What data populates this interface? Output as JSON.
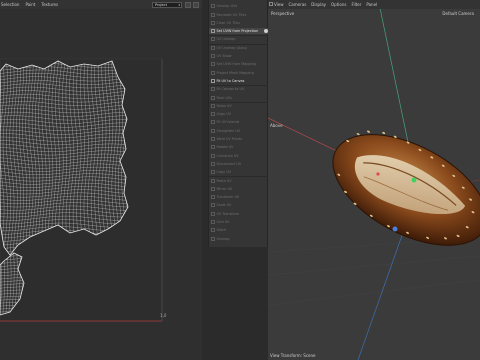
{
  "uv_editor": {
    "menu": [
      "Selection",
      "Paint",
      "Textures"
    ],
    "mode_select": "Project",
    "corner_label": "1,0"
  },
  "command_menu": {
    "items": [
      {
        "label": "Unwrap UVs",
        "enabled": false
      },
      {
        "label": "Recreate UV Tiles",
        "enabled": false
      },
      {
        "label": "Clear UV Tiles",
        "enabled": false
      },
      {
        "label": "Set UVW from Projection",
        "enabled": true,
        "highlighted": true,
        "has_options": true
      },
      {
        "label": "UV Unwrap",
        "enabled": false
      },
      {
        "label": "UV Unwrap (Auto)",
        "enabled": false
      },
      {
        "label": "UV Show",
        "enabled": false
      },
      {
        "label": "Set UVW from Mapping",
        "enabled": false
      },
      {
        "label": "Project Mesh Mapping",
        "enabled": false
      },
      {
        "label": "Fit UV to Canvas",
        "enabled": true
      },
      {
        "label": "Fit Canvas to UV",
        "enabled": false
      },
      {
        "label": "Pack UVs",
        "enabled": false
      },
      {
        "label": "Relax UV",
        "enabled": false
      },
      {
        "label": "Align UV",
        "enabled": false
      },
      {
        "label": "Fit UV Islands",
        "enabled": false
      },
      {
        "label": "Straighten UV",
        "enabled": false
      },
      {
        "label": "Weld UV Points",
        "enabled": false
      },
      {
        "label": "Rotate UV",
        "enabled": false
      },
      {
        "label": "Constrain UV",
        "enabled": false
      },
      {
        "label": "Disconnect UV",
        "enabled": false
      },
      {
        "label": "Copy UV",
        "enabled": false
      },
      {
        "label": "Paste UV",
        "enabled": false
      },
      {
        "label": "Mirror UV",
        "enabled": false
      },
      {
        "label": "Transform UV",
        "enabled": false
      },
      {
        "label": "Scale UV",
        "enabled": false
      },
      {
        "label": "UV Transform",
        "enabled": false
      },
      {
        "label": "Grid UV",
        "enabled": false
      },
      {
        "label": "Stitch",
        "enabled": false
      },
      {
        "label": "Unwrap",
        "enabled": false
      }
    ]
  },
  "viewport": {
    "menu": [
      "View",
      "Cameras",
      "Display",
      "Options",
      "Filter",
      "Panel"
    ],
    "projection": "Perspective",
    "camera": "Default Camera",
    "axis_label": "Above",
    "status": "View Transform: Scene"
  },
  "colors": {
    "uv_background": "#2f2f2f",
    "uv_wire": "#d6d6d6",
    "uv_boundary": "#b03a3a",
    "viewport_background": "#3b3b3b",
    "axis_y": "#4aa37a",
    "axis_x": "#b24a4a",
    "axis_z": "#3f6fb0",
    "bread_crust": "#8a4a1c"
  }
}
